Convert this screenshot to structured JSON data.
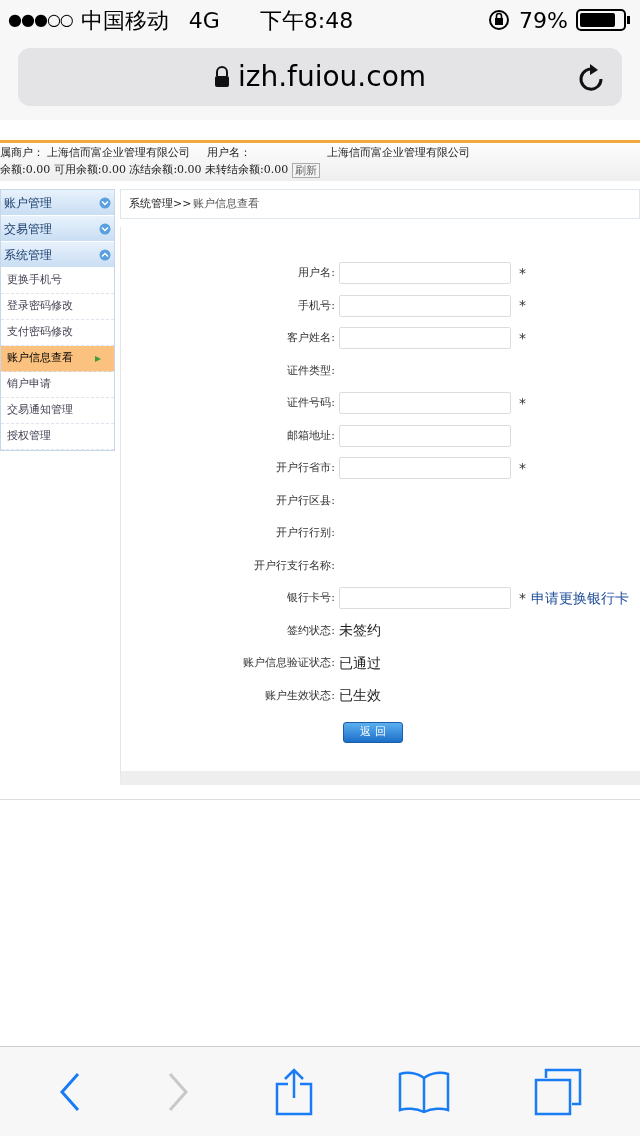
{
  "status_bar": {
    "signal": "●●●○○",
    "carrier": "中国移动",
    "network": "4G",
    "time": "下午8:48",
    "battery": "79%"
  },
  "address_bar": {
    "url": "izh.fuiou.com"
  },
  "merchant_bar": {
    "line_1": [
      "属商户：  上海信而富企业管理有限公司",
      "用户名：",
      "上海信而富企业管理有限公司"
    ],
    "line_2": "余额:0.00 可用余额:0.00 冻结余额:0.00 未转结余额:0.00",
    "refresh_button": "刷新"
  },
  "sidebar": {
    "sections": [
      {
        "label": "账户管理",
        "expanded": false
      },
      {
        "label": "交易管理",
        "expanded": false
      },
      {
        "label": "系统管理",
        "expanded": true,
        "children": [
          {
            "label": "更换手机号",
            "selected": false
          },
          {
            "label": "登录密码修改",
            "selected": false
          },
          {
            "label": "支付密码修改",
            "selected": false
          },
          {
            "label": "账户信息查看",
            "selected": true
          },
          {
            "label": "销户申请",
            "selected": false
          },
          {
            "label": "交易通知管理",
            "selected": false
          },
          {
            "label": "授权管理",
            "selected": false
          }
        ]
      }
    ]
  },
  "breadcrumb": {
    "parent": "系统管理>>",
    "current": "账户信息查看"
  },
  "form": {
    "rows": [
      {
        "label": "用户名:",
        "kind": "input",
        "required": true
      },
      {
        "label": "手机号:",
        "kind": "input",
        "required": true
      },
      {
        "label": "客户姓名:",
        "kind": "input",
        "required": true
      },
      {
        "label": "证件类型:",
        "kind": "empty",
        "required": false
      },
      {
        "label": "证件号码:",
        "kind": "input",
        "required": true
      },
      {
        "label": "邮箱地址:",
        "kind": "input",
        "required": false
      },
      {
        "label": "开户行省市:",
        "kind": "input",
        "required": true
      },
      {
        "label": "开户行区县:",
        "kind": "empty",
        "required": false
      },
      {
        "label": "开户行行别:",
        "kind": "empty",
        "required": false
      },
      {
        "label": "开户行支行名称:",
        "kind": "empty",
        "required": false
      },
      {
        "label": "银行卡号:",
        "kind": "input",
        "required": true,
        "link": "申请更换银行卡"
      },
      {
        "label": "签约状态:",
        "kind": "text",
        "value": "未签约",
        "required": false
      },
      {
        "label": "账户信息验证状态:",
        "kind": "text",
        "value": "已通过",
        "required": false
      },
      {
        "label": "账户生效状态:",
        "kind": "text",
        "value": "已生效",
        "required": false
      }
    ],
    "required_mark": "*",
    "back_button": "返 回"
  },
  "toolbar": {
    "back_enabled": true,
    "forward_enabled": false
  }
}
